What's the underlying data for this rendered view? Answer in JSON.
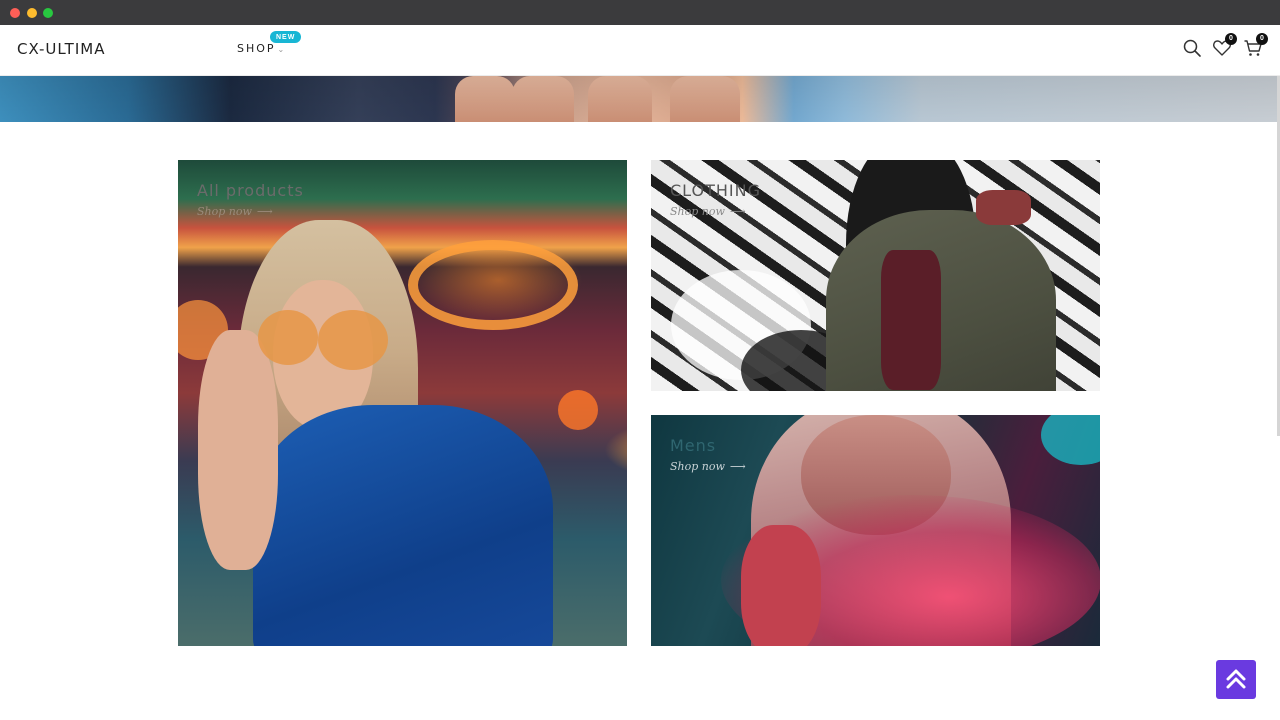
{
  "window": {
    "controls": [
      "close",
      "minimize",
      "maximize"
    ]
  },
  "header": {
    "logo": "CX-ULTIMA",
    "nav": {
      "shop_label": "SHOP",
      "shop_chevron": "⌄",
      "new_badge": "NEW"
    },
    "icons": {
      "search": "search-icon",
      "wishlist": {
        "icon": "heart-icon",
        "count": "0"
      },
      "cart": {
        "icon": "cart-icon",
        "count": "0"
      }
    }
  },
  "tiles": [
    {
      "title": "All products",
      "link": "Shop now",
      "arrow": "⟶",
      "title_color": "#6b6b6b",
      "link_color": "#9a8a7a"
    },
    {
      "title": "CLOTHING",
      "link": "Shop now",
      "arrow": "⟶",
      "title_color": "#555555",
      "link_color": "#8a8a8a"
    },
    {
      "title": "Mens",
      "link": "Shop now",
      "arrow": "⟶",
      "title_color": "#2f6670",
      "link_color": "#c9d3d6"
    }
  ],
  "back_to_top": {
    "icon": "double-chevron-up-icon",
    "color": "#6a3ae0"
  }
}
